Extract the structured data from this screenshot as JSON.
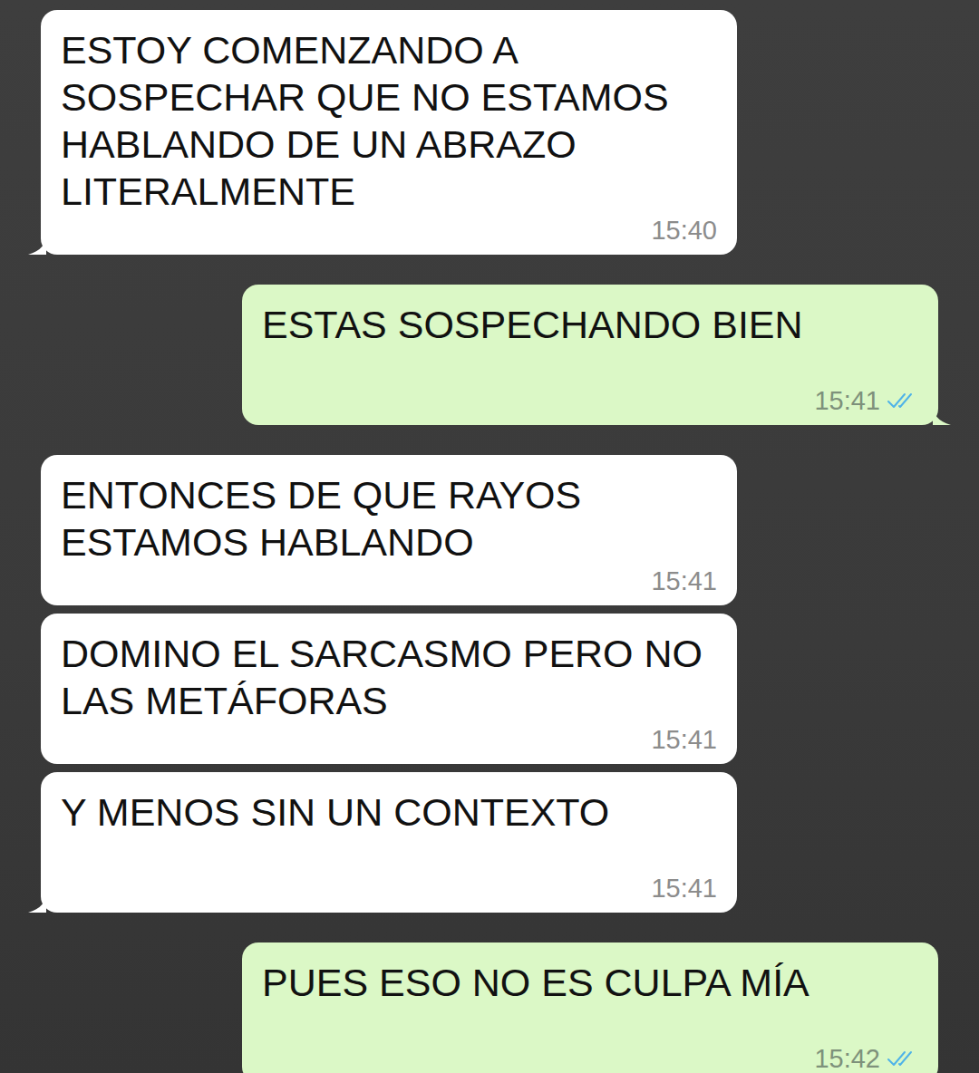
{
  "messages": [
    {
      "kind": "incoming",
      "text": "ESTOY COMENZANDO A SOSPECHAR QUE NO ESTAMOS HABLANDO DE UN ABRAZO LITERALMENTE",
      "time": "15:40",
      "tail": true,
      "read": false
    },
    {
      "kind": "outgoing",
      "text": "ESTAS SOSPECHANDO BIEN",
      "time": "15:41",
      "tail": true,
      "read": true
    },
    {
      "kind": "incoming",
      "text": "ENTONCES DE QUE RAYOS ESTAMOS HABLANDO",
      "time": "15:41",
      "tail": false,
      "read": false
    },
    {
      "kind": "incoming",
      "text": "DOMINO EL SARCASMO PERO NO LAS METÁFORAS",
      "time": "15:41",
      "tail": false,
      "read": false
    },
    {
      "kind": "incoming",
      "text": "Y MENOS SIN UN CONTEXTO",
      "time": "15:41",
      "tail": true,
      "read": false
    },
    {
      "kind": "outgoing",
      "text": "PUES ESO NO ES CULPA MÍA",
      "time": "15:42",
      "tail": true,
      "read": true
    }
  ]
}
